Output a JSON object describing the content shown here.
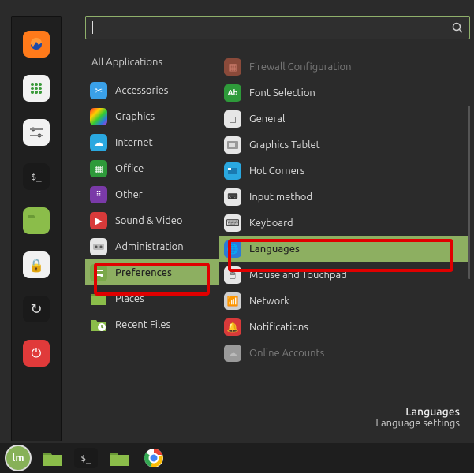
{
  "search": {
    "value": "",
    "placeholder": ""
  },
  "categories": {
    "header": "All Applications",
    "items": [
      {
        "id": "accessories",
        "label": "Accessories",
        "icon_bg": "#3aa0e8",
        "icon_glyph": "✂",
        "icon_fg": "#fff"
      },
      {
        "id": "graphics",
        "label": "Graphics",
        "icon_bg": "linear-gradient(135deg,#ff0000,#ff9900,#33cc33,#0066ff,#cc00cc)",
        "icon_glyph": "",
        "icon_fg": "#fff"
      },
      {
        "id": "internet",
        "label": "Internet",
        "icon_bg": "#2aa8e0",
        "icon_glyph": "☁",
        "icon_fg": "#fff"
      },
      {
        "id": "office",
        "label": "Office",
        "icon_bg": "#2e9a3a",
        "icon_glyph": "▦",
        "icon_fg": "#fff"
      },
      {
        "id": "other",
        "label": "Other",
        "icon_bg": "#7a3aa8",
        "icon_glyph": "⋮⋮",
        "icon_fg": "#fff"
      },
      {
        "id": "sound-video",
        "label": "Sound & Video",
        "icon_bg": "#d83a3a",
        "icon_glyph": "▶",
        "icon_fg": "#fff"
      },
      {
        "id": "administration",
        "label": "Administration",
        "icon_bg": "#e6e6e6",
        "icon_glyph": "▭",
        "icon_fg": "#333"
      },
      {
        "id": "preferences",
        "label": "Preferences",
        "icon_bg": "#7aa84a",
        "icon_glyph": "≡",
        "icon_fg": "#fff",
        "selected": true
      },
      {
        "id": "places",
        "label": "Places",
        "icon_bg": "#7aa84a",
        "icon_glyph": "📁",
        "icon_fg": "#fff"
      },
      {
        "id": "recent-files",
        "label": "Recent Files",
        "icon_bg": "#7aa84a",
        "icon_glyph": "🕘",
        "icon_fg": "#fff"
      }
    ]
  },
  "apps": {
    "items": [
      {
        "id": "firewall",
        "label": "Firewall Configuration",
        "icon_bg": "#b04a3a",
        "icon_glyph": "▦",
        "icon_fg": "#eee",
        "muted": true
      },
      {
        "id": "font-selection",
        "label": "Font Selection",
        "icon_bg": "#2e9a3a",
        "icon_glyph": "Ab",
        "icon_fg": "#fff"
      },
      {
        "id": "general",
        "label": "General",
        "icon_bg": "#e6e6e6",
        "icon_glyph": "◻",
        "icon_fg": "#555"
      },
      {
        "id": "graphics-tablet",
        "label": "Graphics Tablet",
        "icon_bg": "#e6e6e6",
        "icon_glyph": "▭",
        "icon_fg": "#555"
      },
      {
        "id": "hot-corners",
        "label": "Hot Corners",
        "icon_bg": "#2aa8e0",
        "icon_glyph": "◱",
        "icon_fg": "#fff"
      },
      {
        "id": "input-method",
        "label": "Input method",
        "icon_bg": "#e6e6e6",
        "icon_glyph": "⌨",
        "icon_fg": "#333"
      },
      {
        "id": "keyboard",
        "label": "Keyboard",
        "icon_bg": "#e6e6e6",
        "icon_glyph": "⌨",
        "icon_fg": "#333"
      },
      {
        "id": "languages",
        "label": "Languages",
        "icon_bg": "#2a7ad8",
        "icon_glyph": "🌐",
        "icon_fg": "#fff",
        "selected": true
      },
      {
        "id": "mouse-touchpad",
        "label": "Mouse and Touchpad",
        "icon_bg": "#e6e6e6",
        "icon_glyph": "🖱",
        "icon_fg": "#333"
      },
      {
        "id": "network",
        "label": "Network",
        "icon_bg": "#cfcfcf",
        "icon_glyph": "📶",
        "icon_fg": "#555"
      },
      {
        "id": "notifications",
        "label": "Notifications",
        "icon_bg": "#d83a3a",
        "icon_glyph": "🔔",
        "icon_fg": "#fff"
      },
      {
        "id": "online-accounts",
        "label": "Online Accounts",
        "icon_bg": "#cfcfcf",
        "icon_glyph": "☁",
        "icon_fg": "#666",
        "muted": true
      }
    ]
  },
  "favorites": [
    {
      "id": "firefox",
      "bg": "#ff7a1a",
      "glyph": "●",
      "fg": "#fff",
      "name": "firefox-icon"
    },
    {
      "id": "software",
      "bg": "#f2f2f2",
      "glyph": "⊞",
      "fg": "#3a9a3a",
      "name": "software-icon"
    },
    {
      "id": "settings",
      "bg": "#f2f2f2",
      "glyph": "≡",
      "fg": "#333",
      "name": "settings-icon"
    },
    {
      "id": "terminal",
      "bg": "#1a1a1a",
      "glyph": ">_",
      "fg": "#ddd",
      "name": "terminal-icon"
    },
    {
      "id": "files",
      "bg": "#8bbd4a",
      "glyph": "▆",
      "fg": "#6a9a36",
      "name": "files-icon"
    },
    {
      "id": "lock",
      "bg": "#f2f2f2",
      "glyph": "🔒",
      "fg": "#222",
      "name": "lock-icon"
    },
    {
      "id": "logout",
      "bg": "#1a1a1a",
      "glyph": "↻",
      "fg": "#ddd",
      "name": "logout-icon"
    },
    {
      "id": "shutdown",
      "bg": "#e03a3a",
      "glyph": "⏻",
      "fg": "#fff",
      "name": "shutdown-icon"
    }
  ],
  "footer": {
    "title": "Languages",
    "subtitle": "Language settings"
  },
  "taskbar": [
    {
      "id": "menu",
      "name": "start-menu-icon"
    },
    {
      "id": "files",
      "name": "files-icon"
    },
    {
      "id": "terminal",
      "name": "terminal-icon"
    },
    {
      "id": "files2",
      "name": "files-icon"
    },
    {
      "id": "chrome",
      "name": "chrome-icon"
    }
  ]
}
